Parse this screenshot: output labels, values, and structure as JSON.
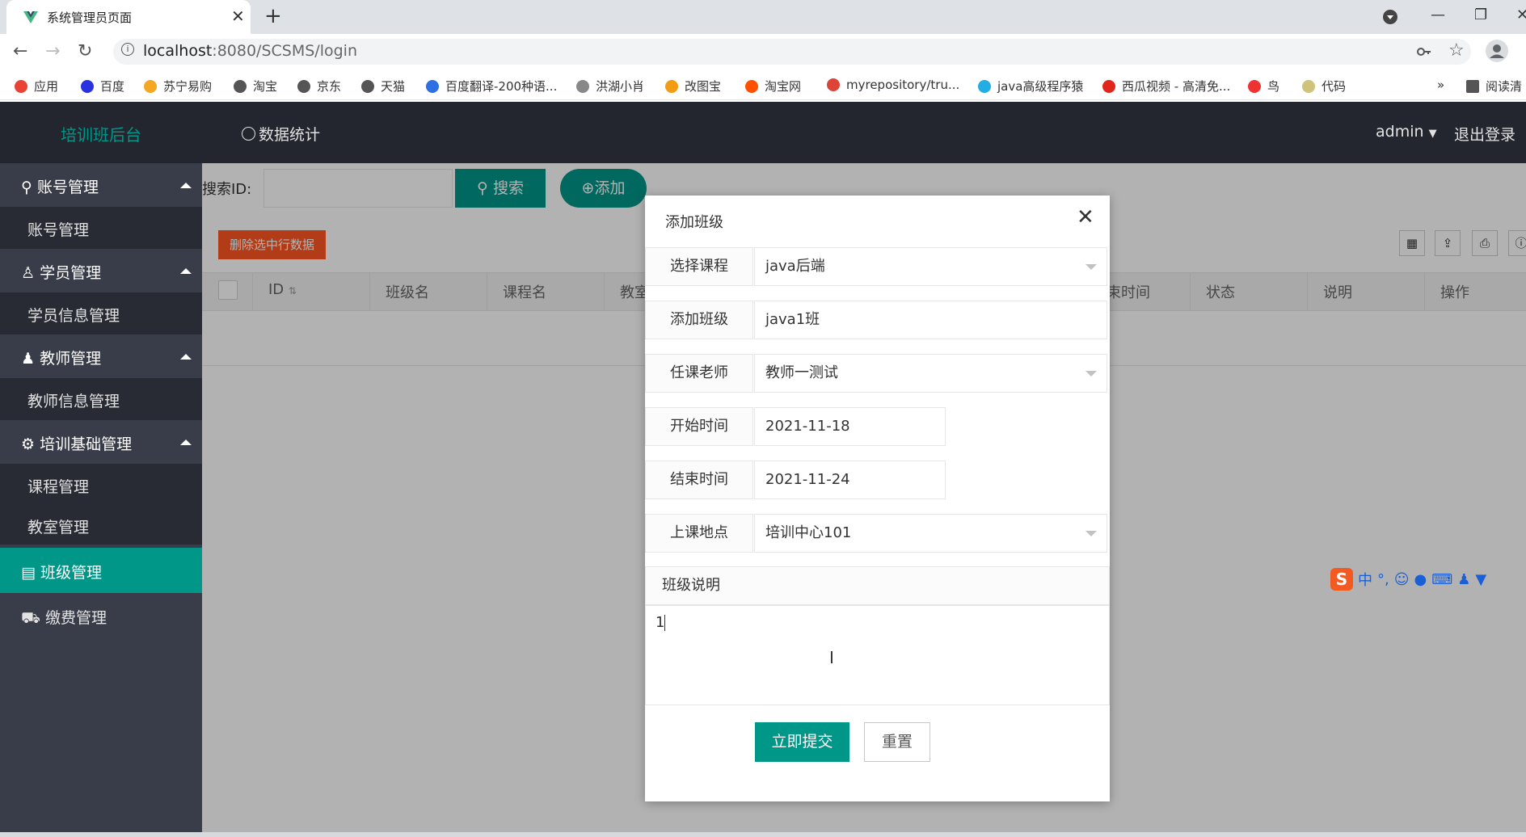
{
  "browser": {
    "tab_title": "系统管理员页面",
    "tab_close": "✕",
    "new_tab": "+",
    "url_host": "localhost",
    "url_rest": ":8080/SCSMS/login",
    "back": "←",
    "forward": "→",
    "reload": "↻",
    "window_minimize": "—",
    "window_restore": "❐",
    "window_close": "✕",
    "bookmarks": [
      {
        "label": "应用",
        "icon": "apps-grid-icon",
        "color": "#e94335"
      },
      {
        "label": "百度",
        "icon": "baidu-icon",
        "color": "#2932e1"
      },
      {
        "label": "苏宁易购",
        "icon": "suning-icon",
        "color": "#f5a623"
      },
      {
        "label": "淘宝",
        "icon": "globe-icon",
        "color": "#555555"
      },
      {
        "label": "京东",
        "icon": "globe-icon",
        "color": "#555555"
      },
      {
        "label": "天猫",
        "icon": "globe-icon",
        "color": "#555555"
      },
      {
        "label": "百度翻译-200种语...",
        "icon": "translate-icon",
        "color": "#2f6fe4"
      },
      {
        "label": "洪湖小肖",
        "icon": "bird-icon",
        "color": "#888888"
      },
      {
        "label": "改图宝",
        "icon": "gaitubao-icon",
        "color": "#f39c12"
      },
      {
        "label": "淘宝网",
        "icon": "taobao-icon",
        "color": "#ff5000"
      },
      {
        "label": "myrepository/tru...",
        "icon": "chrome-icon",
        "color": "#db4437"
      },
      {
        "label": "java高级程序猿",
        "icon": "bilibili-icon",
        "color": "#23ade5"
      },
      {
        "label": "西瓜视频 - 高清免...",
        "icon": "xigua-icon",
        "color": "#e1251b"
      },
      {
        "label": "鸟",
        "icon": "bird-red-icon",
        "color": "#e33"
      },
      {
        "label": "代码",
        "icon": "code-icon",
        "color": "#cfc27a"
      }
    ],
    "bookmarks_more": "»",
    "reading_list": "阅读清"
  },
  "header": {
    "logo": "培训班后台",
    "nav_stats": "数据统计",
    "user": "admin",
    "logout": "退出登录"
  },
  "sidebar": {
    "groups": [
      {
        "label": "账号管理",
        "icon": "key-icon",
        "children": [
          "账号管理"
        ]
      },
      {
        "label": "学员管理",
        "icon": "user-icon",
        "children": [
          "学员信息管理"
        ]
      },
      {
        "label": "教师管理",
        "icon": "person-icon",
        "children": [
          "教师信息管理"
        ]
      },
      {
        "label": "培训基础管理",
        "icon": "gear-icon",
        "children": [
          "课程管理",
          "教室管理"
        ]
      }
    ],
    "active": {
      "label": "班级管理",
      "icon": "list-icon"
    },
    "plain": {
      "label": "缴费管理",
      "icon": "cart-icon"
    }
  },
  "toolbar": {
    "search_label": "搜索ID:",
    "search_value": "",
    "search_button": "搜索",
    "add_button": "添加",
    "delete_button": "删除选中行数据"
  },
  "table": {
    "columns": [
      "ID",
      "班级名",
      "课程名",
      "教室",
      "束时间",
      "状态",
      "说明",
      "操作"
    ]
  },
  "modal": {
    "title": "添加班级",
    "close": "✕",
    "fields": [
      {
        "label": "选择课程",
        "value": "java后端",
        "type": "select"
      },
      {
        "label": "添加班级",
        "value": "java1班",
        "type": "text"
      },
      {
        "label": "任课老师",
        "value": "教师一测试",
        "type": "select"
      },
      {
        "label": "开始时间",
        "value": "2021-11-18",
        "type": "date"
      },
      {
        "label": "结束时间",
        "value": "2021-11-24",
        "type": "date"
      },
      {
        "label": "上课地点",
        "value": "培训中心101",
        "type": "select"
      }
    ],
    "description_label": "班级说明",
    "description_value": "1",
    "submit": "立即提交",
    "reset": "重置"
  },
  "ime": {
    "logo": "S",
    "mode": "中"
  },
  "colors": {
    "accent": "#009688",
    "danger": "#ff5722",
    "header_bg": "#23262e",
    "sidebar_bg": "#393d49"
  }
}
